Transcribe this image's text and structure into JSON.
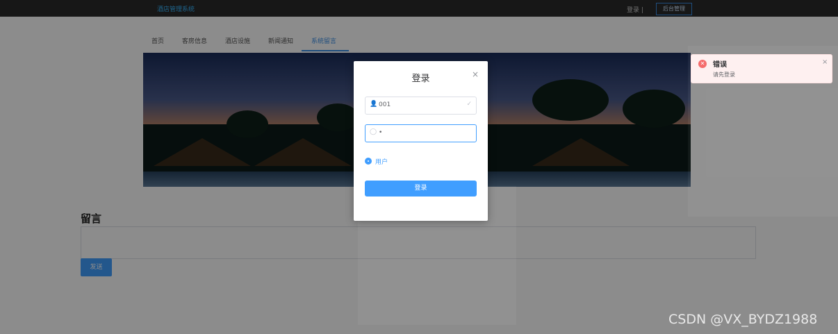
{
  "header": {
    "brand": "酒店管理系统",
    "login_link": "登录 |",
    "admin_button": "后台管理"
  },
  "nav": {
    "items": [
      "首页",
      "客房信息",
      "酒店设施",
      "新闻通知",
      "系统留言"
    ],
    "active_index": 4
  },
  "message_section": {
    "title": "留言",
    "send_button": "发送"
  },
  "login_modal": {
    "title": "登录",
    "close_icon": "×",
    "username_value": "001",
    "password_value": "•",
    "role_option": "用户",
    "submit": "登录"
  },
  "toast": {
    "title": "错误",
    "message": "请先登录",
    "type": "error"
  },
  "watermark": "CSDN @VX_BYDZ1988",
  "colors": {
    "primary": "#409eff",
    "topbar": "#2b2b2b",
    "error": "#f56c6c"
  },
  "icons": {
    "user": "user-icon",
    "lock": "lock-icon",
    "check": "check-icon",
    "close": "close-icon",
    "error": "error-icon"
  }
}
